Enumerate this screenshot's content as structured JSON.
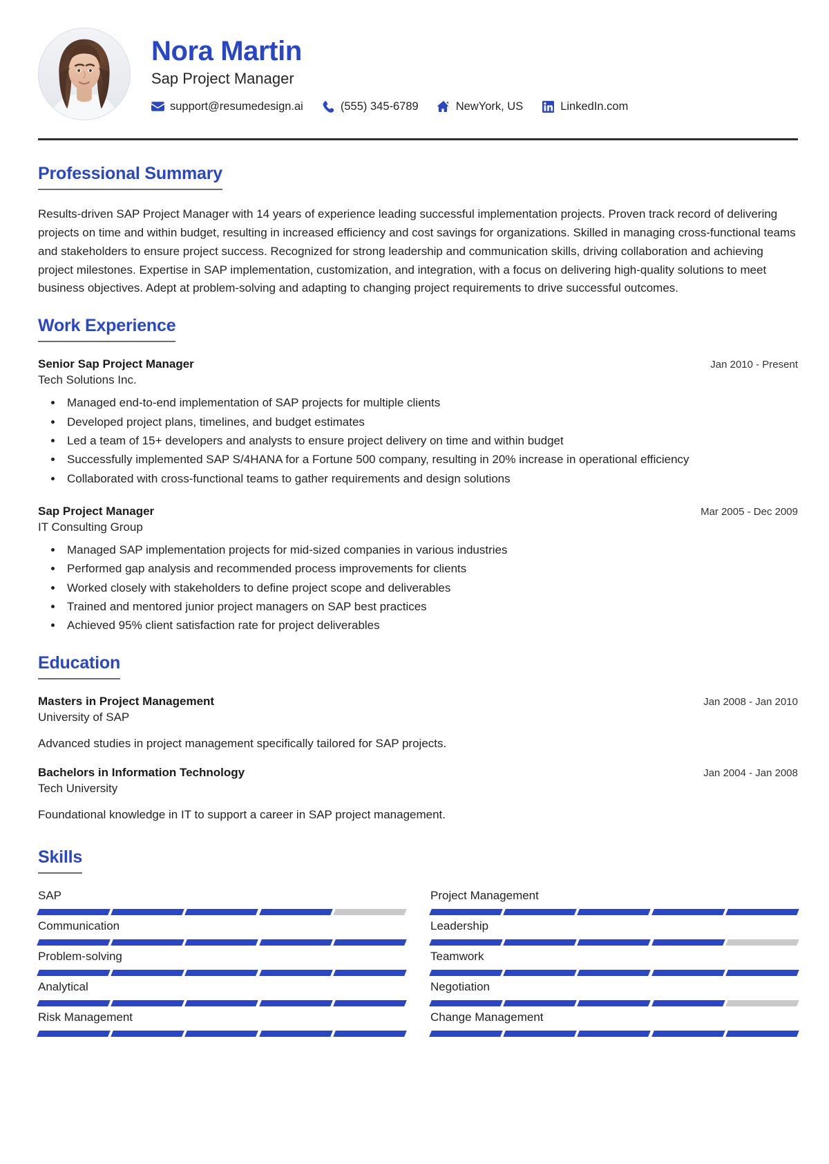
{
  "header": {
    "name": "Nora Martin",
    "job_title": "Sap Project Manager",
    "avatar_alt": "profile-photo",
    "contacts": [
      {
        "icon": "email-icon",
        "text": "support@resumedesign.ai"
      },
      {
        "icon": "phone-icon",
        "text": "(555) 345-6789"
      },
      {
        "icon": "home-icon",
        "text": "NewYork, US"
      },
      {
        "icon": "linkedin-icon",
        "text": "LinkedIn.com"
      }
    ]
  },
  "sections": {
    "summary": {
      "heading": "Professional Summary",
      "text": "Results-driven SAP Project Manager with 14 years of experience leading successful implementation projects. Proven track record of delivering projects on time and within budget, resulting in increased efficiency and cost savings for organizations. Skilled in managing cross-functional teams and stakeholders to ensure project success. Recognized for strong leadership and communication skills, driving collaboration and achieving project milestones. Expertise in SAP implementation, customization, and integration, with a focus on delivering high-quality solutions to meet business objectives. Adept at problem-solving and adapting to changing project requirements to drive successful outcomes."
    },
    "experience": {
      "heading": "Work Experience",
      "entries": [
        {
          "title": "Senior Sap Project Manager",
          "date": "Jan 2010 - Present",
          "organization": "Tech Solutions Inc.",
          "bullets": [
            "Managed end-to-end implementation of SAP projects for multiple clients",
            "Developed project plans, timelines, and budget estimates",
            "Led a team of 15+ developers and analysts to ensure project delivery on time and within budget",
            "Successfully implemented SAP S/4HANA for a Fortune 500 company, resulting in 20% increase in operational efficiency",
            "Collaborated with cross-functional teams to gather requirements and design solutions"
          ]
        },
        {
          "title": "Sap Project Manager",
          "date": "Mar 2005 - Dec 2009",
          "organization": "IT Consulting Group",
          "bullets": [
            "Managed SAP implementation projects for mid-sized companies in various industries",
            "Performed gap analysis and recommended process improvements for clients",
            "Worked closely with stakeholders to define project scope and deliverables",
            "Trained and mentored junior project managers on SAP best practices",
            "Achieved 95% client satisfaction rate for project deliverables"
          ]
        }
      ]
    },
    "education": {
      "heading": "Education",
      "entries": [
        {
          "title": "Masters in Project Management",
          "date": "Jan 2008 - Jan 2010",
          "organization": "University of SAP",
          "description": "Advanced studies in project management specifically tailored for SAP projects."
        },
        {
          "title": "Bachelors in Information Technology",
          "date": "Jan 2004 - Jan 2008",
          "organization": "Tech University",
          "description": "Foundational knowledge in IT to support a career in SAP project management."
        }
      ]
    },
    "skills": {
      "heading": "Skills",
      "segments_total": 5,
      "items": [
        {
          "label": "SAP",
          "filled": 4
        },
        {
          "label": "Project Management",
          "filled": 5
        },
        {
          "label": "Communication",
          "filled": 5
        },
        {
          "label": "Leadership",
          "filled": 4
        },
        {
          "label": "Problem-solving",
          "filled": 5
        },
        {
          "label": "Teamwork",
          "filled": 5
        },
        {
          "label": "Analytical",
          "filled": 5
        },
        {
          "label": "Negotiation",
          "filled": 4
        },
        {
          "label": "Risk Management",
          "filled": 5
        },
        {
          "label": "Change Management",
          "filled": 5
        }
      ]
    }
  },
  "colors": {
    "accent": "#2a46c8",
    "bar_filled": "#2a46c8",
    "bar_empty": "#c9c9c9",
    "rule": "#2e2e2e",
    "heading_underline": "#6b6b6b"
  }
}
